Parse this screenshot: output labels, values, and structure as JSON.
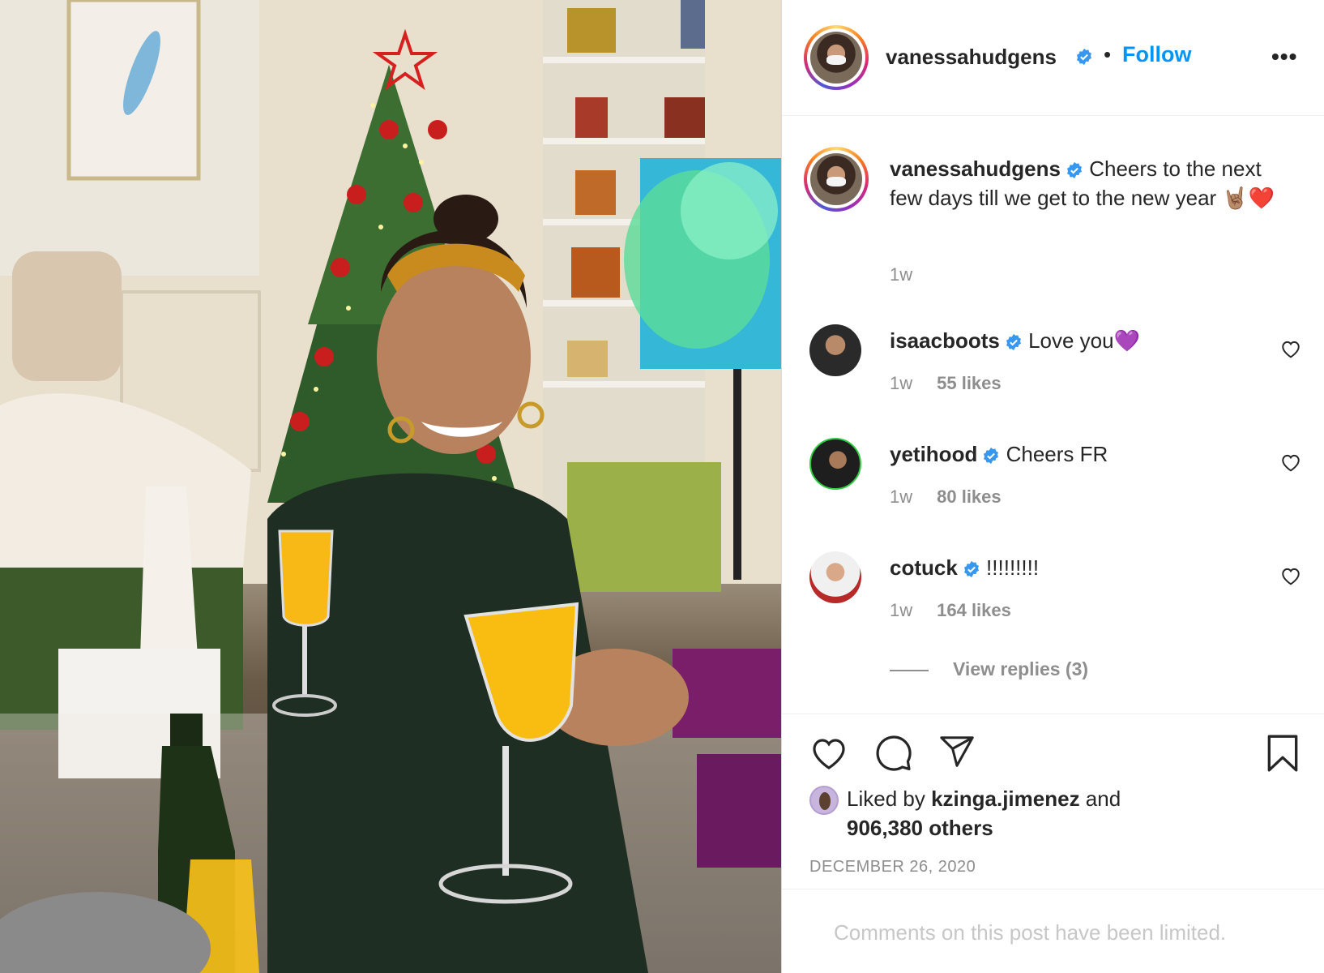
{
  "post": {
    "username": "vanessahudgens",
    "follow_label": "Follow",
    "dot": "•",
    "more_label": "•••",
    "caption": {
      "text": "Cheers to the next few days till we get to the new year 🤘🏽❤️",
      "time": "1w"
    },
    "comments": [
      {
        "username": "isaacboots",
        "text": "Love you💜",
        "time": "1w",
        "likes": "55 likes"
      },
      {
        "username": "yetihood",
        "text": "Cheers FR",
        "time": "1w",
        "likes": "80 likes"
      },
      {
        "username": "cotuck",
        "text": "!!!!!!!!!",
        "time": "1w",
        "likes": "164 likes"
      }
    ],
    "view_replies": "View replies (3)",
    "liked_by": {
      "prefix": "Liked by ",
      "user": "kzinga.jimenez",
      "suffix": " and",
      "others": "906,380 others"
    },
    "date": "December 26, 2020",
    "comments_limited": "Comments on this post have been limited."
  },
  "icons": {
    "verified": "verified-badge-icon",
    "like": "heart-icon",
    "comment": "comment-bubble-icon",
    "share": "paper-plane-icon",
    "save": "bookmark-icon"
  },
  "colors": {
    "accent": "#0095f6",
    "muted": "#8e8e8e",
    "text": "#262626",
    "limited": "#c7c7c7"
  }
}
